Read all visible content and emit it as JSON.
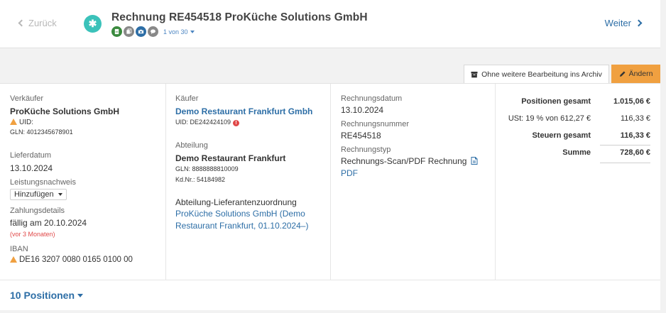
{
  "header": {
    "back_label": "Zurück",
    "next_label": "Weiter",
    "title": "Rechnung RE454518 ProKüche Solutions GmbH",
    "pager": "1 von 30"
  },
  "actions": {
    "archive_label": "Ohne weitere Bearbeitung ins Archiv",
    "edit_label": "Ändern"
  },
  "seller": {
    "label": "Verkäufer",
    "name": "ProKüche Solutions GmbH",
    "uid": "UID:",
    "gln": "GLN: 4012345678901",
    "delivery_date_label": "Lieferdatum",
    "delivery_date": "13.10.2024",
    "proof_label": "Leistungsnachweis",
    "proof_select": "Hinzufügen",
    "payment_label": "Zahlungsdetails",
    "payment_due": "fällig am 20.10.2024",
    "payment_overdue": "(vor 3 Monaten)",
    "iban_label": "IBAN",
    "iban": "DE16 3207 0080 0165 0100 00"
  },
  "buyer": {
    "label": "Käufer",
    "name": "Demo Restaurant Frankfurt Gmbh",
    "uid": "UID: DE242424109",
    "dept_label": "Abteilung",
    "dept_name": "Demo Restaurant Frankfurt",
    "dept_gln": "GLN: 8888888810009",
    "dept_customer_no": "Kd.Nr.: 54184982",
    "assignment_label": "Abteilung-Lieferantenzuordnung",
    "assignment_line1": "ProKüche Solutions GmbH (Demo",
    "assignment_line2": "Restaurant Frankfurt, 01.10.2024–)"
  },
  "invoice": {
    "date_label": "Rechnungsdatum",
    "date": "13.10.2024",
    "number_label": "Rechnungsnummer",
    "number": "RE454518",
    "type_label": "Rechnungstyp",
    "type_line1": "Rechnungs-Scan/PDF Rechnung",
    "type_link": "PDF"
  },
  "totals": {
    "positions_label": "Positionen gesamt",
    "positions_value": "1.015,06 €",
    "vat_label": "USt: 19 % von 612,27 €",
    "vat_value": "116,33 €",
    "tax_total_label": "Steuern gesamt",
    "tax_total_value": "116,33 €",
    "sum_label": "Summe",
    "sum_value": "728,60 €"
  },
  "footer": {
    "positions_toggle": "10 Positionen"
  },
  "colors": {
    "accent": "#2d6ea6",
    "logo": "#3bc2ba",
    "edit_button": "#f0a040",
    "warning": "#f0a040",
    "error": "#e04848"
  },
  "icons": [
    "chevron-left-icon",
    "chevron-right-icon",
    "logo-icon",
    "document-badge-icon",
    "copy-badge-icon",
    "camera-badge-icon",
    "comment-badge-icon",
    "archive-icon",
    "pencil-icon",
    "warning-icon",
    "error-icon",
    "pdf-icon",
    "caret-down-icon"
  ]
}
